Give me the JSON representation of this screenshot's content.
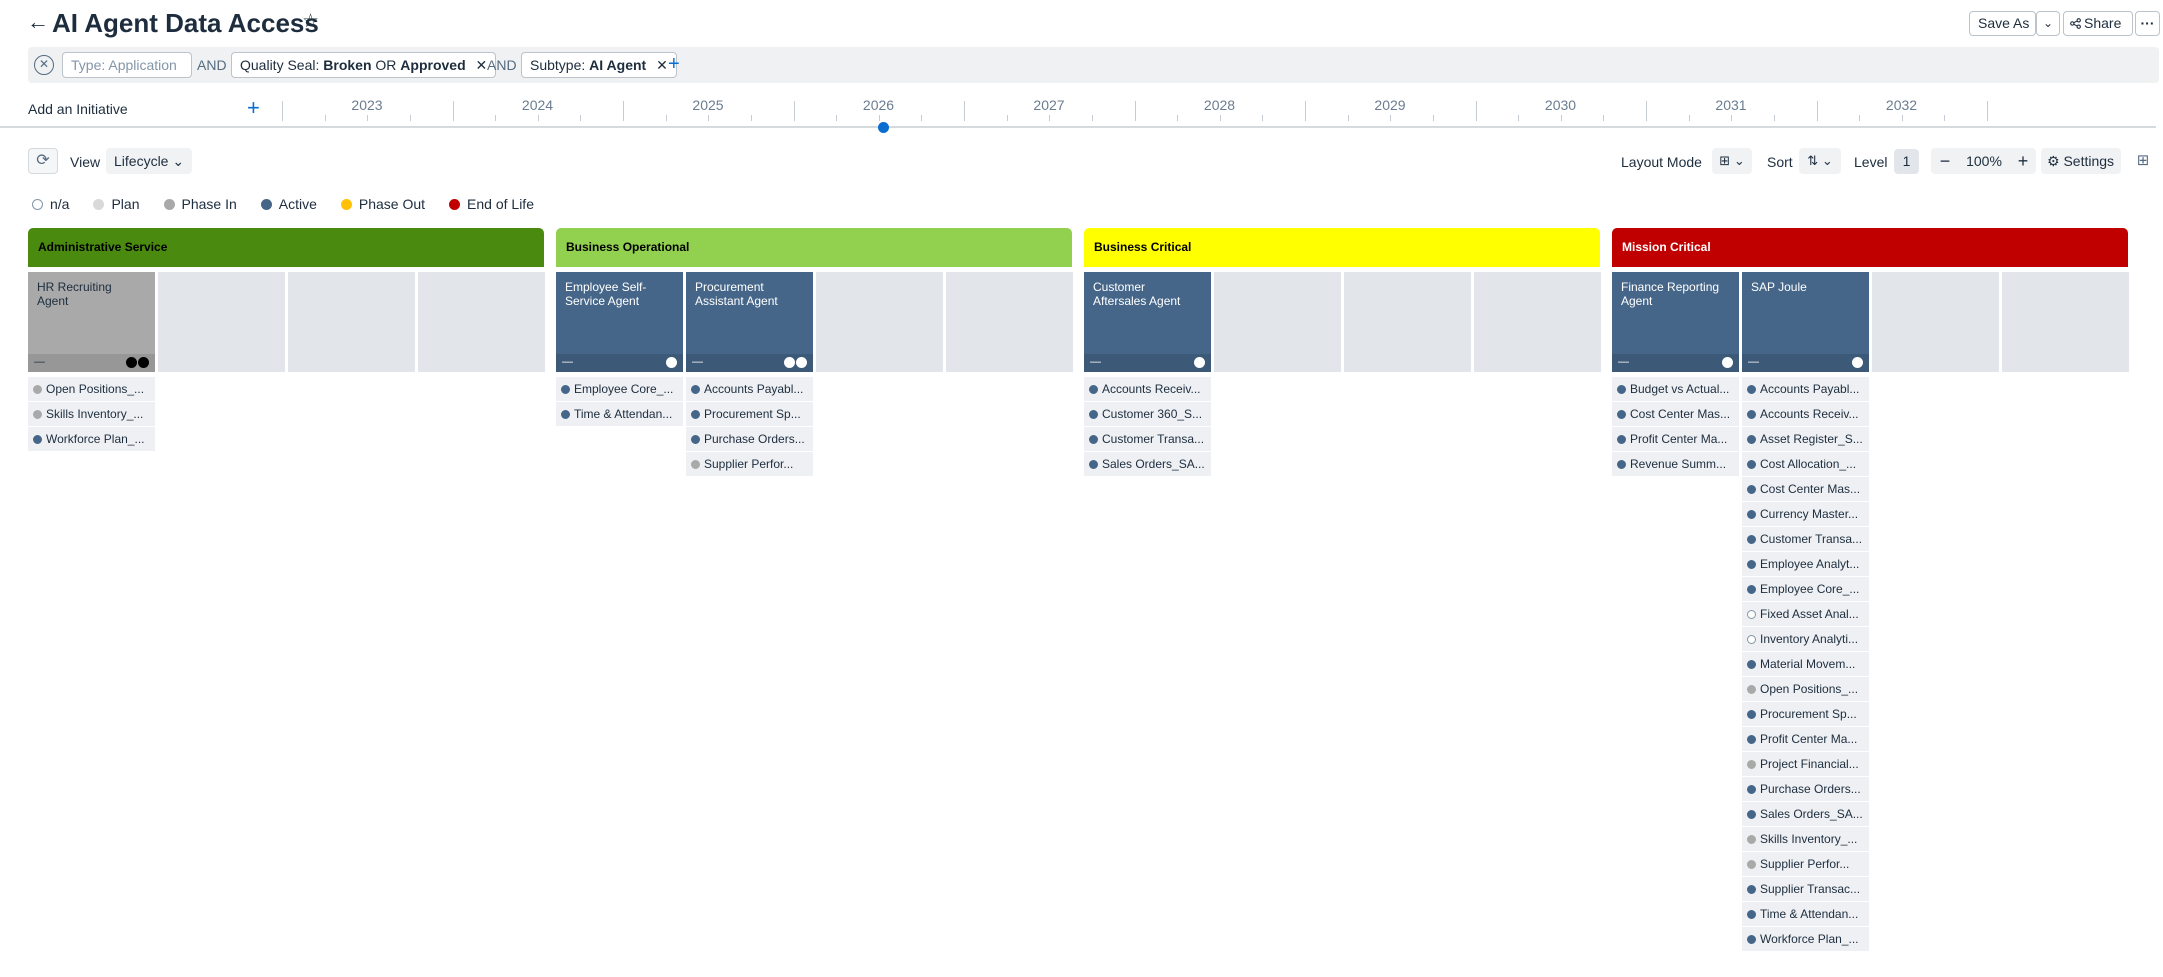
{
  "header": {
    "title": "AI Agent Data Access",
    "back_icon": "←",
    "star_icon": "☆",
    "save_as_label": "Save As",
    "save_as_dropdown_icon": "⌄",
    "share_label": "Share",
    "more_icon": "···"
  },
  "filters": {
    "clear_icon": "✕",
    "type_placeholder": "Type: Application",
    "and_1": "AND",
    "quality_prefix": "Quality Seal:",
    "quality_value_1": "Broken",
    "quality_or": "OR",
    "quality_value_2": "Approved",
    "and_2": "AND",
    "subtype_prefix": "Subtype:",
    "subtype_value": "AI Agent",
    "remove_icon": "✕",
    "add_icon": "+"
  },
  "timeline": {
    "add_initiative_label": "Add an Initiative",
    "add_icon": "+",
    "years": [
      "2023",
      "2024",
      "2025",
      "2026",
      "2027",
      "2028",
      "2029",
      "2030",
      "2031",
      "2032"
    ]
  },
  "toolbar": {
    "refresh_icon": "⟳",
    "view_label": "View",
    "view_value": "Lifecycle",
    "dropdown_icon": "⌄",
    "layout_mode_label": "Layout Mode",
    "layout_icon": "⊞",
    "sort_label": "Sort",
    "sort_icon": "⇅",
    "level_label": "Level",
    "level_value": "1",
    "zoom_out_icon": "−",
    "zoom_value": "100%",
    "zoom_in_icon": "+",
    "settings_icon": "⚙",
    "settings_label": "Settings",
    "side_panel_icon": "⊞"
  },
  "legend": [
    {
      "label": "n/a",
      "color": "#ffffff",
      "border": "#8396a8"
    },
    {
      "label": "Plan",
      "color": "#d9d9d9",
      "border": "#d9d9d9"
    },
    {
      "label": "Phase In",
      "color": "#a9a9a9",
      "border": "#a9a9a9"
    },
    {
      "label": "Active",
      "color": "#456688",
      "border": "#456688"
    },
    {
      "label": "Phase Out",
      "color": "#ffc107",
      "border": "#ffc107"
    },
    {
      "label": "End of Life",
      "color": "#c00000",
      "border": "#c00000"
    }
  ],
  "colors": {
    "active": "#456688",
    "phase_in": "#a9a9a9",
    "na": "#ffffff",
    "group_administrative": "#4a8a0e",
    "group_operational": "#92d050",
    "group_critical": "#ffff00",
    "group_mission": "#c00000"
  },
  "groups": [
    {
      "name": "Administrative Service",
      "color": "#4a8a0e",
      "text_color": "#000000",
      "cards": [
        {
          "name": "HR Recruiting Agent",
          "style": "gray",
          "dots": [
            "#000000",
            "#000000"
          ],
          "items": [
            {
              "label": "Open Positions_...",
              "status": "phase_in"
            },
            {
              "label": "Skills Inventory_...",
              "status": "phase_in"
            },
            {
              "label": "Workforce Plan_...",
              "status": "active"
            }
          ]
        }
      ]
    },
    {
      "name": "Business Operational",
      "color": "#92d050",
      "text_color": "#000000",
      "cards": [
        {
          "name": "Employee Self-Service Agent",
          "style": "blue",
          "dots": [
            "#ffffff"
          ],
          "items": [
            {
              "label": "Employee Core_...",
              "status": "active"
            },
            {
              "label": "Time & Attendan...",
              "status": "active"
            }
          ]
        },
        {
          "name": "Procurement Assistant Agent",
          "style": "blue",
          "dots": [
            "#ffffff",
            "#ffffff"
          ],
          "items": [
            {
              "label": "Accounts Payabl...",
              "status": "active"
            },
            {
              "label": "Procurement Sp...",
              "status": "active"
            },
            {
              "label": "Purchase Orders...",
              "status": "active"
            },
            {
              "label": "Supplier Perfor...",
              "status": "phase_in"
            }
          ]
        }
      ]
    },
    {
      "name": "Business Critical",
      "color": "#ffff00",
      "text_color": "#000000",
      "cards": [
        {
          "name": "Customer Aftersales Agent",
          "style": "blue",
          "dots": [
            "#ffffff"
          ],
          "items": [
            {
              "label": "Accounts Receiv...",
              "status": "active"
            },
            {
              "label": "Customer 360_S...",
              "status": "active"
            },
            {
              "label": "Customer Transa...",
              "status": "active"
            },
            {
              "label": "Sales Orders_SA...",
              "status": "active"
            }
          ]
        }
      ]
    },
    {
      "name": "Mission Critical",
      "color": "#c00000",
      "text_color": "#ffffff",
      "cards": [
        {
          "name": "Finance Reporting Agent",
          "style": "blue",
          "dots": [
            "#ffffff"
          ],
          "items": [
            {
              "label": "Budget vs Actual...",
              "status": "active"
            },
            {
              "label": "Cost Center Mas...",
              "status": "active"
            },
            {
              "label": "Profit Center Ma...",
              "status": "active"
            },
            {
              "label": "Revenue Summ...",
              "status": "active"
            }
          ]
        },
        {
          "name": "SAP Joule",
          "style": "blue",
          "dots": [
            "#ffffff"
          ],
          "items": [
            {
              "label": "Accounts Payabl...",
              "status": "active"
            },
            {
              "label": "Accounts Receiv...",
              "status": "active"
            },
            {
              "label": "Asset Register_S...",
              "status": "active"
            },
            {
              "label": "Cost Allocation_...",
              "status": "active"
            },
            {
              "label": "Cost Center Mas...",
              "status": "active"
            },
            {
              "label": "Currency Master...",
              "status": "active"
            },
            {
              "label": "Customer Transa...",
              "status": "active"
            },
            {
              "label": "Employee Analyt...",
              "status": "active"
            },
            {
              "label": "Employee Core_...",
              "status": "active"
            },
            {
              "label": "Fixed Asset Anal...",
              "status": "na"
            },
            {
              "label": "Inventory Analyti...",
              "status": "na"
            },
            {
              "label": "Material Movem...",
              "status": "active"
            },
            {
              "label": "Open Positions_...",
              "status": "phase_in"
            },
            {
              "label": "Procurement Sp...",
              "status": "active"
            },
            {
              "label": "Profit Center Ma...",
              "status": "active"
            },
            {
              "label": "Project Financial...",
              "status": "phase_in"
            },
            {
              "label": "Purchase Orders...",
              "status": "active"
            },
            {
              "label": "Sales Orders_SA...",
              "status": "active"
            },
            {
              "label": "Skills Inventory_...",
              "status": "phase_in"
            },
            {
              "label": "Supplier Perfor...",
              "status": "phase_in"
            },
            {
              "label": "Supplier Transac...",
              "status": "active"
            },
            {
              "label": "Time & Attendan...",
              "status": "active"
            },
            {
              "label": "Workforce Plan_...",
              "status": "active"
            }
          ]
        }
      ]
    }
  ]
}
